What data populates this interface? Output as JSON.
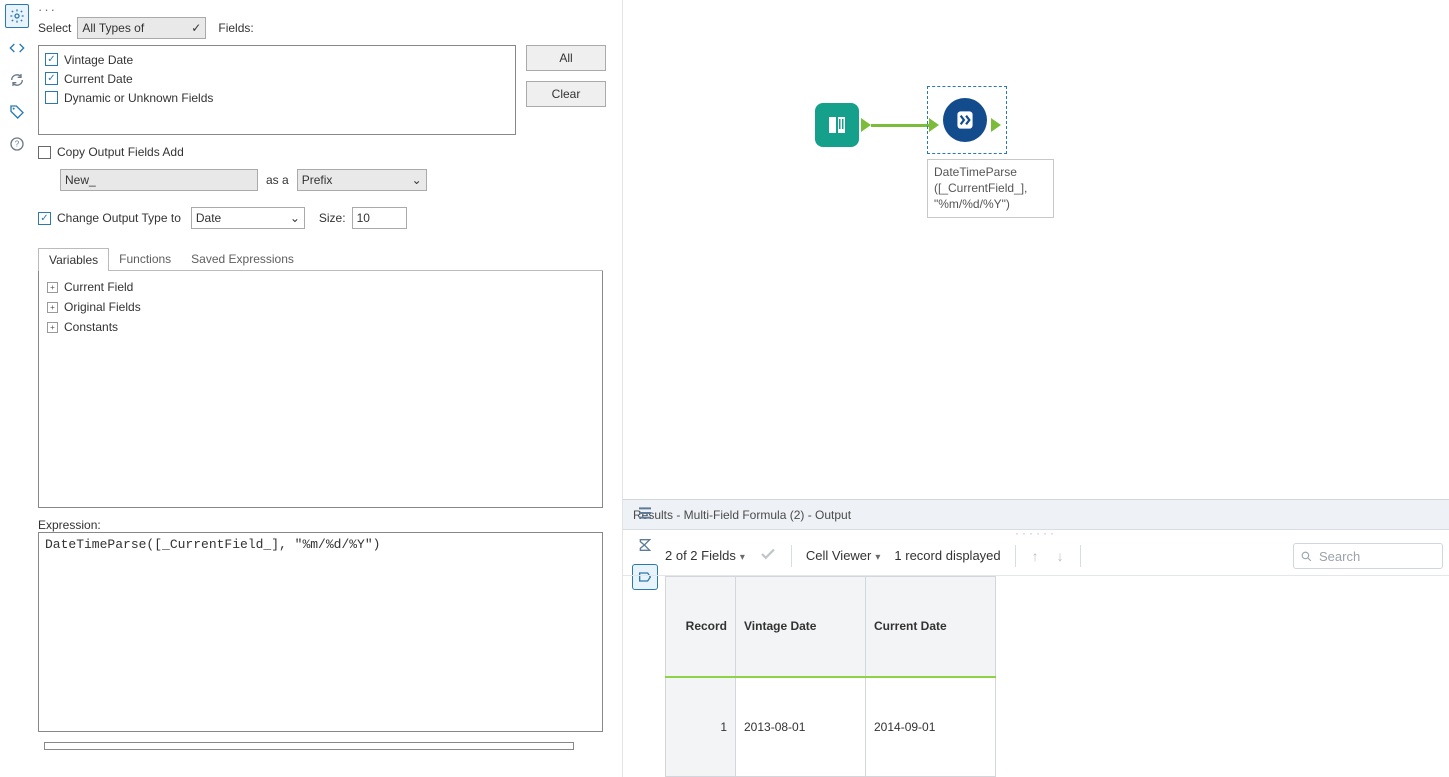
{
  "left_rail": {
    "gear": "gear",
    "code": "code",
    "refresh": "refresh",
    "tag": "tag",
    "help": "help"
  },
  "config": {
    "select_label": "Select",
    "select_types_value": "All Types of",
    "fields_label": "Fields:",
    "btn_all": "All",
    "btn_clear": "Clear",
    "field_list": {
      "f1": "Vintage Date",
      "f2": "Current Date",
      "f3": "Dynamic or Unknown Fields"
    },
    "copy_output_label": "Copy Output Fields Add",
    "new_prefix_value": "New_",
    "as_a_label": "as a",
    "prefix_value": "Prefix",
    "change_output_label": "Change Output Type to",
    "output_type_value": "Date",
    "size_label": "Size:",
    "size_value": "10",
    "tabs": {
      "variables": "Variables",
      "functions": "Functions",
      "saved": "Saved Expressions"
    },
    "tree": {
      "n1": "Current Field",
      "n2": "Original Fields",
      "n3": "Constants"
    },
    "expr_label": "Expression:",
    "expr_value": "DateTimeParse([_CurrentField_], \"%m/%d/%Y\")"
  },
  "canvas": {
    "node_label_line1": "DateTimeParse",
    "node_label_line2": "([_CurrentField_],",
    "node_label_line3": "\"%m/%d/%Y\")"
  },
  "results": {
    "title": "Results - Multi-Field Formula (2) - Output",
    "fields_summary": "2 of 2 Fields",
    "cell_viewer": "Cell Viewer",
    "records_summary": "1 record displayed",
    "search_placeholder": "Search",
    "table": {
      "h_record": "Record",
      "h_vintage": "Vintage Date",
      "h_current": "Current Date",
      "r1_idx": "1",
      "r1_vintage": "2013-08-01",
      "r1_current": "2014-09-01"
    }
  }
}
